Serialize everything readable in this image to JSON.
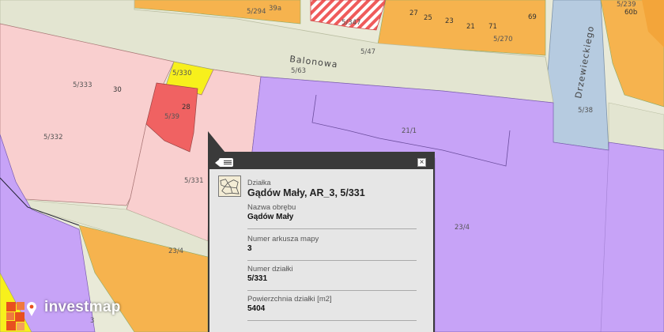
{
  "map": {
    "street_labels": [
      "Balonowa",
      "Drzewieckiego"
    ],
    "parcel_labels": [
      "5/294",
      "39a",
      "5/347",
      "27",
      "25",
      "23",
      "21",
      "71",
      "69",
      "5/270",
      "5/239",
      "60b",
      "5/47",
      "5/63",
      "5/330",
      "5/333",
      "30",
      "28",
      "5/39",
      "5/332",
      "5/331",
      "5/38",
      "21/1",
      "23/4",
      "23/4",
      "3"
    ],
    "colors": {
      "background": "#e9ead8",
      "road": "#e3e5d1",
      "pink": "#f9cfcf",
      "red": "#f06262",
      "yellow": "#f7f01c",
      "purple": "#c7a3f7",
      "orange": "#f6b34e",
      "blue": "#b6cbe0"
    }
  },
  "popup": {
    "kind": "Działka",
    "title": "Gądów Mały, AR_3, 5/331",
    "fields": [
      {
        "label": "Nazwa obrębu",
        "value": "Gądów Mały"
      },
      {
        "label": "Numer arkusza mapy",
        "value": "3"
      },
      {
        "label": "Numer działki",
        "value": "5/331"
      },
      {
        "label": "Powierzchnia działki [m2]",
        "value": "5404"
      }
    ],
    "list_icon": "list-icon",
    "close_icon": "close-icon",
    "close_symbol": "×"
  },
  "logo": {
    "text": "investmap",
    "icon": "investmap-logo-icon"
  }
}
